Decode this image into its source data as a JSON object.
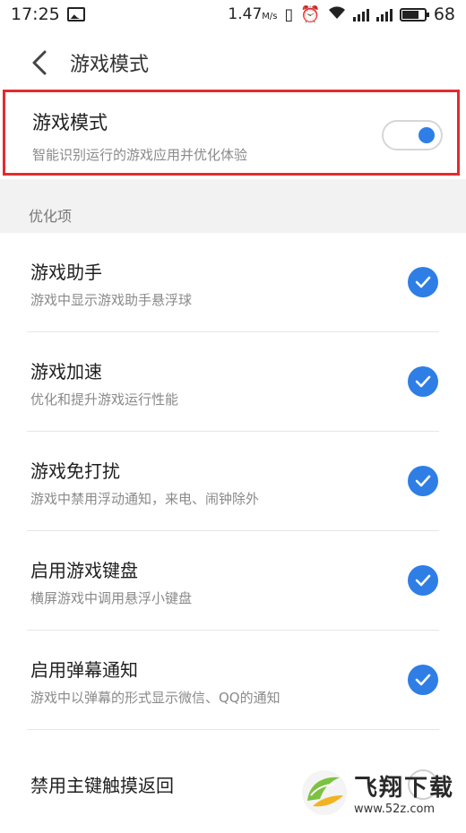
{
  "status_bar": {
    "time": "17:25",
    "speed_value": "1.47",
    "speed_unit": "M/s",
    "battery": "68"
  },
  "header": {
    "title": "游戏模式"
  },
  "game_mode": {
    "title": "游戏模式",
    "description": "智能识别运行的游戏应用并优化体验",
    "enabled": true
  },
  "section": {
    "label": "优化项"
  },
  "options": [
    {
      "title": "游戏助手",
      "description": "游戏中显示游戏助手悬浮球",
      "checked": true
    },
    {
      "title": "游戏加速",
      "description": "优化和提升游戏运行性能",
      "checked": true
    },
    {
      "title": "游戏免打扰",
      "description": "游戏中禁用浮动通知，来电、闹钟除外",
      "checked": true
    },
    {
      "title": "启用游戏键盘",
      "description": "横屏游戏中调用悬浮小键盘",
      "checked": true
    },
    {
      "title": "启用弹幕通知",
      "description": "游戏中以弹幕的形式显示微信、QQ的通知",
      "checked": true
    },
    {
      "title": "禁用主键触摸返回",
      "description": "",
      "checked": false
    }
  ],
  "watermark": {
    "name": "飞翔下载",
    "url": "www.52z.com"
  },
  "colors": {
    "accent": "#2e7ee6",
    "highlight_border": "#e52b2b"
  }
}
